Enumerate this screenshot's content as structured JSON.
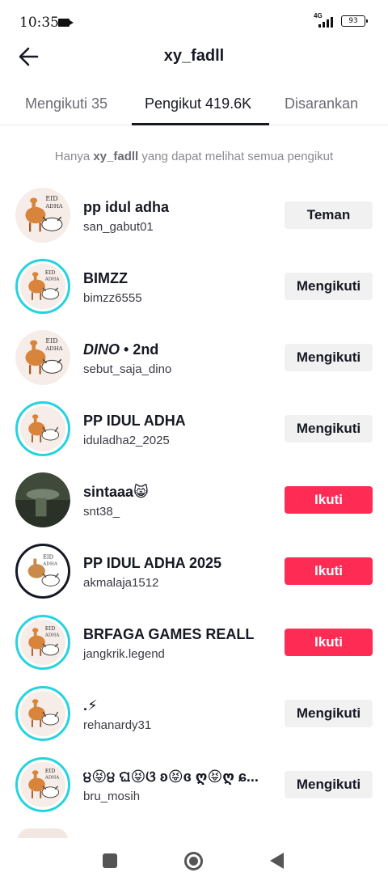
{
  "status_bar": {
    "time": "10:35",
    "network": "4G",
    "battery": "93"
  },
  "header": {
    "title": "xy_fadll"
  },
  "tabs": [
    {
      "label": "Mengikuti 35"
    },
    {
      "label": "Pengikut 419.6K"
    },
    {
      "label": "Disarankan"
    }
  ],
  "notice": {
    "prefix": "Hanya ",
    "username": "xy_fadll",
    "suffix": " yang dapat melihat semua pengikut"
  },
  "avatar_text": {
    "line1": "EID",
    "line2": "ADHA"
  },
  "followers": [
    {
      "name": "pp idul adha",
      "username": "san_gabut01",
      "button": "Teman"
    },
    {
      "name": "BIMZZ",
      "username": "bimzz6555",
      "button": "Mengikuti"
    },
    {
      "name_italic": "DINO",
      "name_rest": " • 2nd",
      "username": "sebut_saja_dino",
      "button": "Mengikuti"
    },
    {
      "name": "PP IDUL ADHA",
      "username": "iduladha2_2025",
      "button": "Mengikuti"
    },
    {
      "name": "sintaaa😸",
      "username": "snt38_",
      "button": "Ikuti"
    },
    {
      "name": "PP IDUL ADHA 2025",
      "username": "akmalaja1512",
      "button": "Ikuti"
    },
    {
      "name": "BRFAGA GAMES REALL",
      "username": "jangkrik.legend",
      "button": "Ikuti"
    },
    {
      "name": ".⚡",
      "username": "rehanardy31",
      "button": "Mengikuti"
    },
    {
      "name": "੪😝੪ ଘ😝ଓ ʚ😝ɞ ღ😝ღ ɕ...",
      "username": "bru_mosih",
      "button": "Mengikuti"
    }
  ],
  "colors": {
    "accent": "#fe2c55",
    "story_ring": "#25d3e0",
    "secondary_button": "#f1f1f2",
    "text": "#161823"
  }
}
